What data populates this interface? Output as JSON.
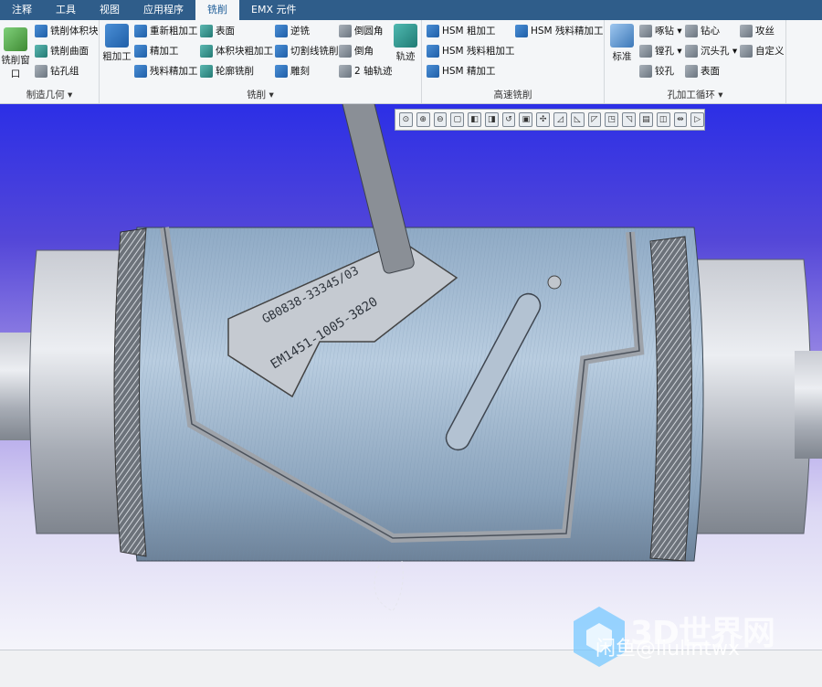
{
  "tabs": [
    {
      "label": "注释",
      "active": false
    },
    {
      "label": "工具",
      "active": false
    },
    {
      "label": "视图",
      "active": false
    },
    {
      "label": "应用程序",
      "active": false
    },
    {
      "label": "铣削",
      "active": true
    },
    {
      "label": "EMX 元件",
      "active": false
    }
  ],
  "groups": {
    "manufacturing_geometry": {
      "label": "制造几何 ▾",
      "items": [
        "铣削体积块",
        "铣削曲面",
        "钻孔组"
      ],
      "window_label": "铣削窗口"
    },
    "milling": {
      "label": "铣削 ▾",
      "rough_label": "粗加工",
      "col1": [
        "重新粗加工",
        "精加工",
        "残料精加工"
      ],
      "col2": [
        "表面",
        "体积块粗加工",
        "轮廓铣削"
      ],
      "col3": [
        "逆铣",
        "切割线铣削",
        "雕刻"
      ],
      "col4": [
        "倒圆角",
        "倒角",
        "2 轴轨迹"
      ],
      "trajectory_label": "轨迹"
    },
    "high_speed": {
      "label": "高速铣削",
      "col1": [
        "HSM 粗加工",
        "HSM 残料粗加工",
        "HSM 精加工"
      ],
      "col2": [
        "HSM 残料精加工"
      ]
    },
    "hole_cycle": {
      "label": "孔加工循环 ▾",
      "standard_label": "标准",
      "col1": [
        "啄钻 ▾",
        "镗孔 ▾",
        "铰孔"
      ],
      "col2": [
        "钻心",
        "沉头孔 ▾",
        "表面"
      ],
      "col3": [
        "攻丝",
        "自定义"
      ]
    }
  },
  "view_tools": [
    "⊙",
    "⊕",
    "⊖",
    "▢",
    "◧",
    "◨",
    "↺",
    "▣",
    "✣",
    "◿",
    "◺",
    "◸",
    "◳",
    "◹",
    "▤",
    "◫",
    "⇹",
    "▷"
  ],
  "emboss_text_1": "EM1451-1005-3820",
  "emboss_text_2": "GB0838-33345/03",
  "watermark_logo": "3D世界网",
  "watermark_user": "闲鱼@liulintwx",
  "colors": {
    "tabbar": "#2f5d8a",
    "active_tab_text": "#1a5a96",
    "part": "#9fb7cc",
    "edge": "#3a4652"
  }
}
